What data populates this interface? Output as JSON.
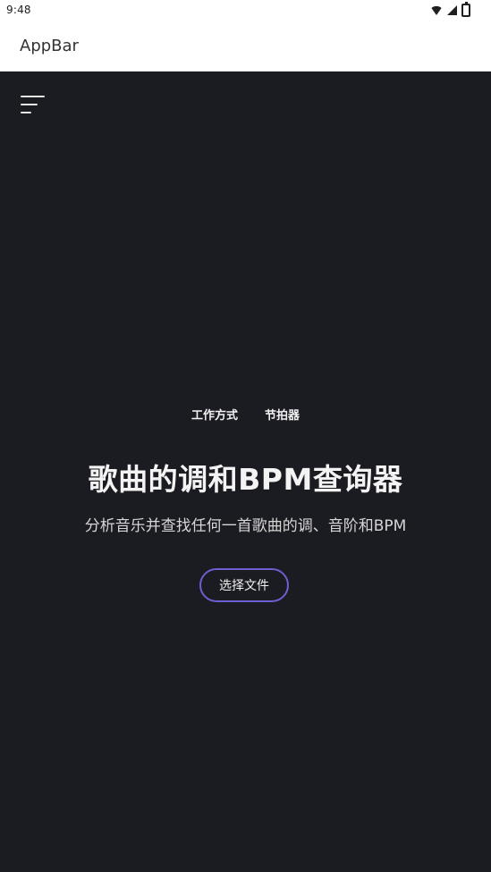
{
  "status_bar": {
    "time": "9:48",
    "icons": [
      "wifi-icon",
      "signal-icon",
      "battery-icon"
    ]
  },
  "appbar": {
    "title": "AppBar"
  },
  "menu": {
    "icon": "menu-icon"
  },
  "nav": {
    "items": [
      {
        "label": "工作方式"
      },
      {
        "label": "节拍器"
      }
    ]
  },
  "hero": {
    "title": "歌曲的调和BPM查询器",
    "subtitle": "分析音乐并查找任何一首歌曲的调、音阶和BPM",
    "button_label": "选择文件"
  },
  "colors": {
    "background": "#1b1b22",
    "accent": "#6b5fd1",
    "text": "#f3f3f3"
  }
}
